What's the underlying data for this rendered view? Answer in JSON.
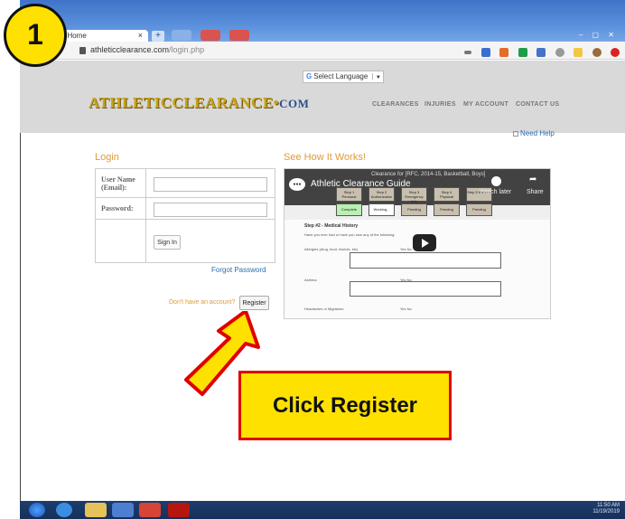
{
  "annotation": {
    "step_number": "1",
    "callout_text": "Click Register"
  },
  "browser": {
    "tab_title": "ance - Home",
    "tab_close": "×",
    "new_tab": "+",
    "url_domain": "athleticclearance.com",
    "url_path": "/login.php"
  },
  "site": {
    "translate_label": "Select Language",
    "translate_arrow": "▼",
    "logo_main": "ATHLETICCLEARANCE",
    "logo_dot": "•",
    "logo_com": "COM",
    "nav": [
      "CLEARANCES",
      "INJURIES",
      "MY ACCOUNT",
      "CONTACT US"
    ],
    "need_help": "Need Help"
  },
  "login": {
    "title": "Login",
    "username_label": "User Name (Email):",
    "password_label": "Password:",
    "sign_in": "Sign In",
    "forgot_password": "Forgot Password",
    "no_account": "Don't have an account?",
    "register": "Register"
  },
  "video": {
    "heading": "See How It Works!",
    "title": "Athletic Clearance Guide",
    "caption": "Clearance for [RFC, 2014-15, Basketball, Boys]",
    "watch_later": "Watch later",
    "share": "Share",
    "steps": [
      "Step 1 Personal",
      "Step 2 Authorization",
      "Step 3 Emergency Info",
      "Step 4 Physical",
      "Step 5 Waivers"
    ],
    "statuses": [
      "Complete",
      "Working...",
      "Pending",
      "Pending",
      "Pending"
    ],
    "section_title": "Step #2 - Medical History",
    "intro": "Have you ever had or have you now any of the following:",
    "q1": "Allergies (drug, food, insects, etc)",
    "q1_sub": "List Allergies/Reason:",
    "q2": "Asthma",
    "q2_sub": "Medications Used:",
    "q3": "Headaches or Migraines",
    "yes_no": "Yes No"
  },
  "taskbar": {
    "time": "11:50 AM",
    "date": "11/19/2019"
  }
}
